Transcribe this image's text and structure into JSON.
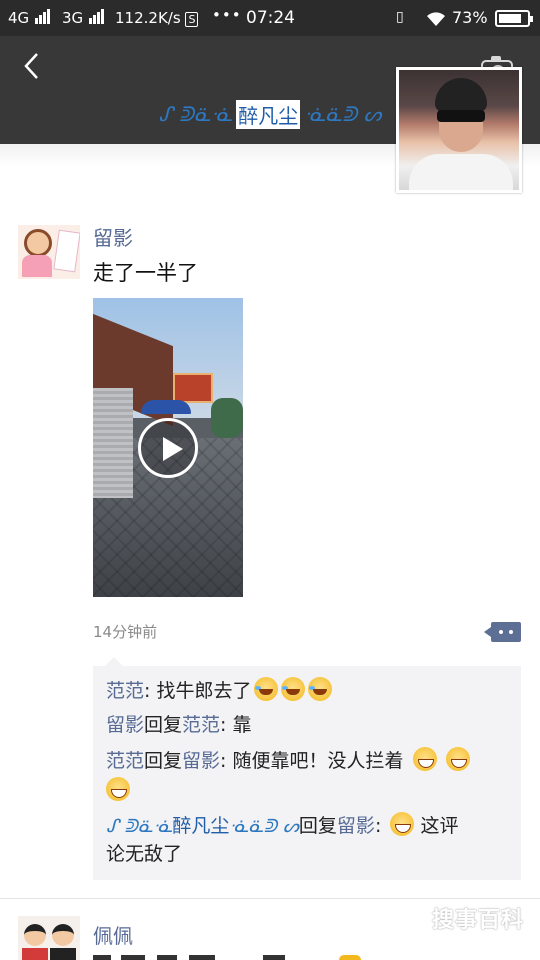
{
  "status_bar": {
    "network1": "4G",
    "network2": "3G",
    "speed": "112.2K/s",
    "dots": "•••",
    "time": "07:24",
    "battery": "73%"
  },
  "owner": {
    "name": "醉凡尘",
    "swirl_left": "ᔑ ᕲᓏᓍ",
    "swirl_right": "ᓍᓏᕲ ᔕ"
  },
  "post1": {
    "author": "留影",
    "text": "走了一半了",
    "time": "14分钟前",
    "comments": [
      {
        "name": "范范",
        "sep": ": ",
        "text": "找牛郎去了"
      },
      {
        "name": "留影",
        "mid": "回复",
        "target": "范范",
        "sep": ": ",
        "text": "靠"
      },
      {
        "name": "范范",
        "mid": "回复",
        "target": "留影",
        "sep": ": ",
        "text": "随便靠吧！没人拦着"
      },
      {
        "mid": "回复",
        "target": "留影",
        "sep": ": ",
        "text": "这评",
        "text2": "论无敌了"
      }
    ]
  },
  "post2": {
    "author": "佩佩"
  },
  "watermark": "搜事百科",
  "colors": {
    "link": "#576b95",
    "header": "#383838",
    "comment_bg": "#f3f3f5"
  }
}
